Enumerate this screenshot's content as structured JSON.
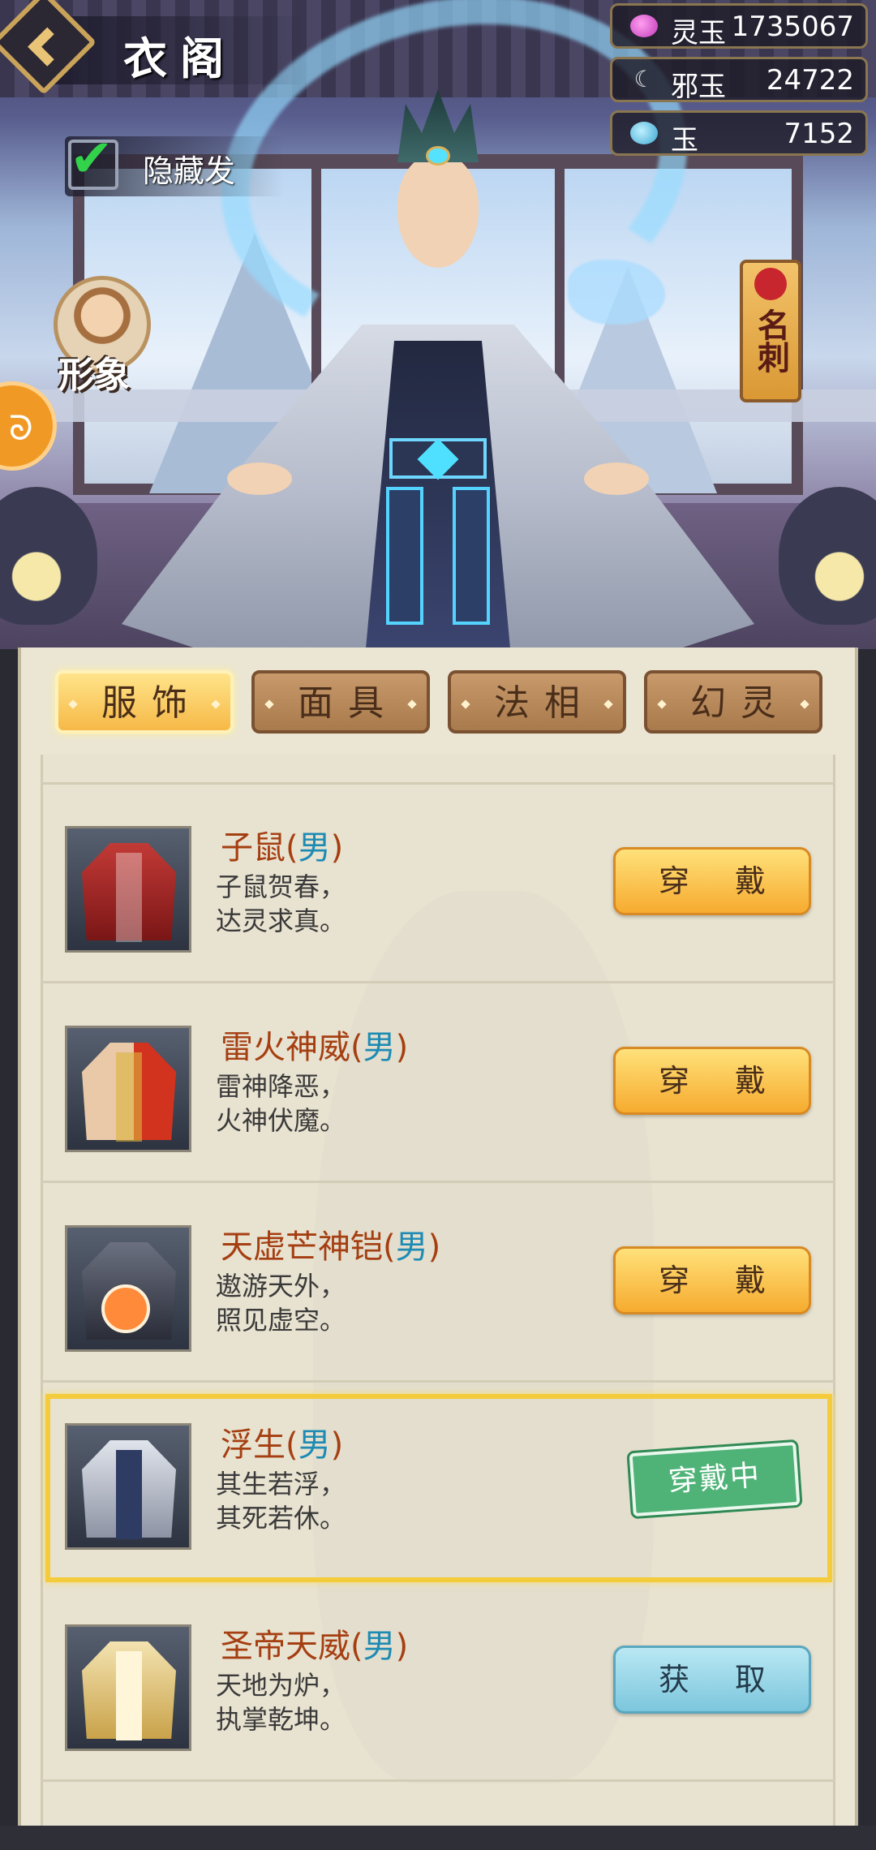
{
  "header": {
    "title": "衣阁"
  },
  "hide_option": {
    "label": "隐藏发",
    "checked": true
  },
  "currencies": [
    {
      "name": "灵玉",
      "value": "1735067",
      "icon": "purple-jade-icon",
      "color": "#d85ad6"
    },
    {
      "name": "邪玉",
      "value": "24722",
      "icon": "crescent-moon-icon",
      "color": "#3a3a3a"
    },
    {
      "name": "玉",
      "value": "7152",
      "icon": "jade-icon",
      "color": "#4ab0d0"
    }
  ],
  "side_buttons": {
    "portrait_label": "形象",
    "card_label": "名刺",
    "side_tab_icon": "spiral-icon"
  },
  "tabs": [
    {
      "label": "服饰",
      "active": true
    },
    {
      "label": "面具",
      "active": false
    },
    {
      "label": "法相",
      "active": false
    },
    {
      "label": "幻灵",
      "active": false
    }
  ],
  "items": [
    {
      "name": "子鼠",
      "gender": "男",
      "desc1": "子鼠贺春，",
      "desc2": "达灵求真。",
      "action": "穿  戴",
      "state": "wear",
      "color": "#b8262a"
    },
    {
      "name": "雷火神威",
      "gender": "男",
      "desc1": "雷神降恶，",
      "desc2": "火神伏魔。",
      "action": "穿  戴",
      "state": "wear",
      "color": "#d94a2a"
    },
    {
      "name": "天虚芒神铠",
      "gender": "男",
      "desc1": "遨游天外，",
      "desc2": "照见虚空。",
      "action": "穿  戴",
      "state": "wear",
      "color": "#5a6070"
    },
    {
      "name": "浮生",
      "gender": "男",
      "desc1": "其生若浮，",
      "desc2": "其死若休。",
      "action": "穿戴中",
      "state": "wearing",
      "color": "#c8ccd8"
    },
    {
      "name": "圣帝天威",
      "gender": "男",
      "desc1": "天地为炉，",
      "desc2": "执掌乾坤。",
      "action": "获  取",
      "state": "get",
      "color": "#e6c35a"
    }
  ]
}
